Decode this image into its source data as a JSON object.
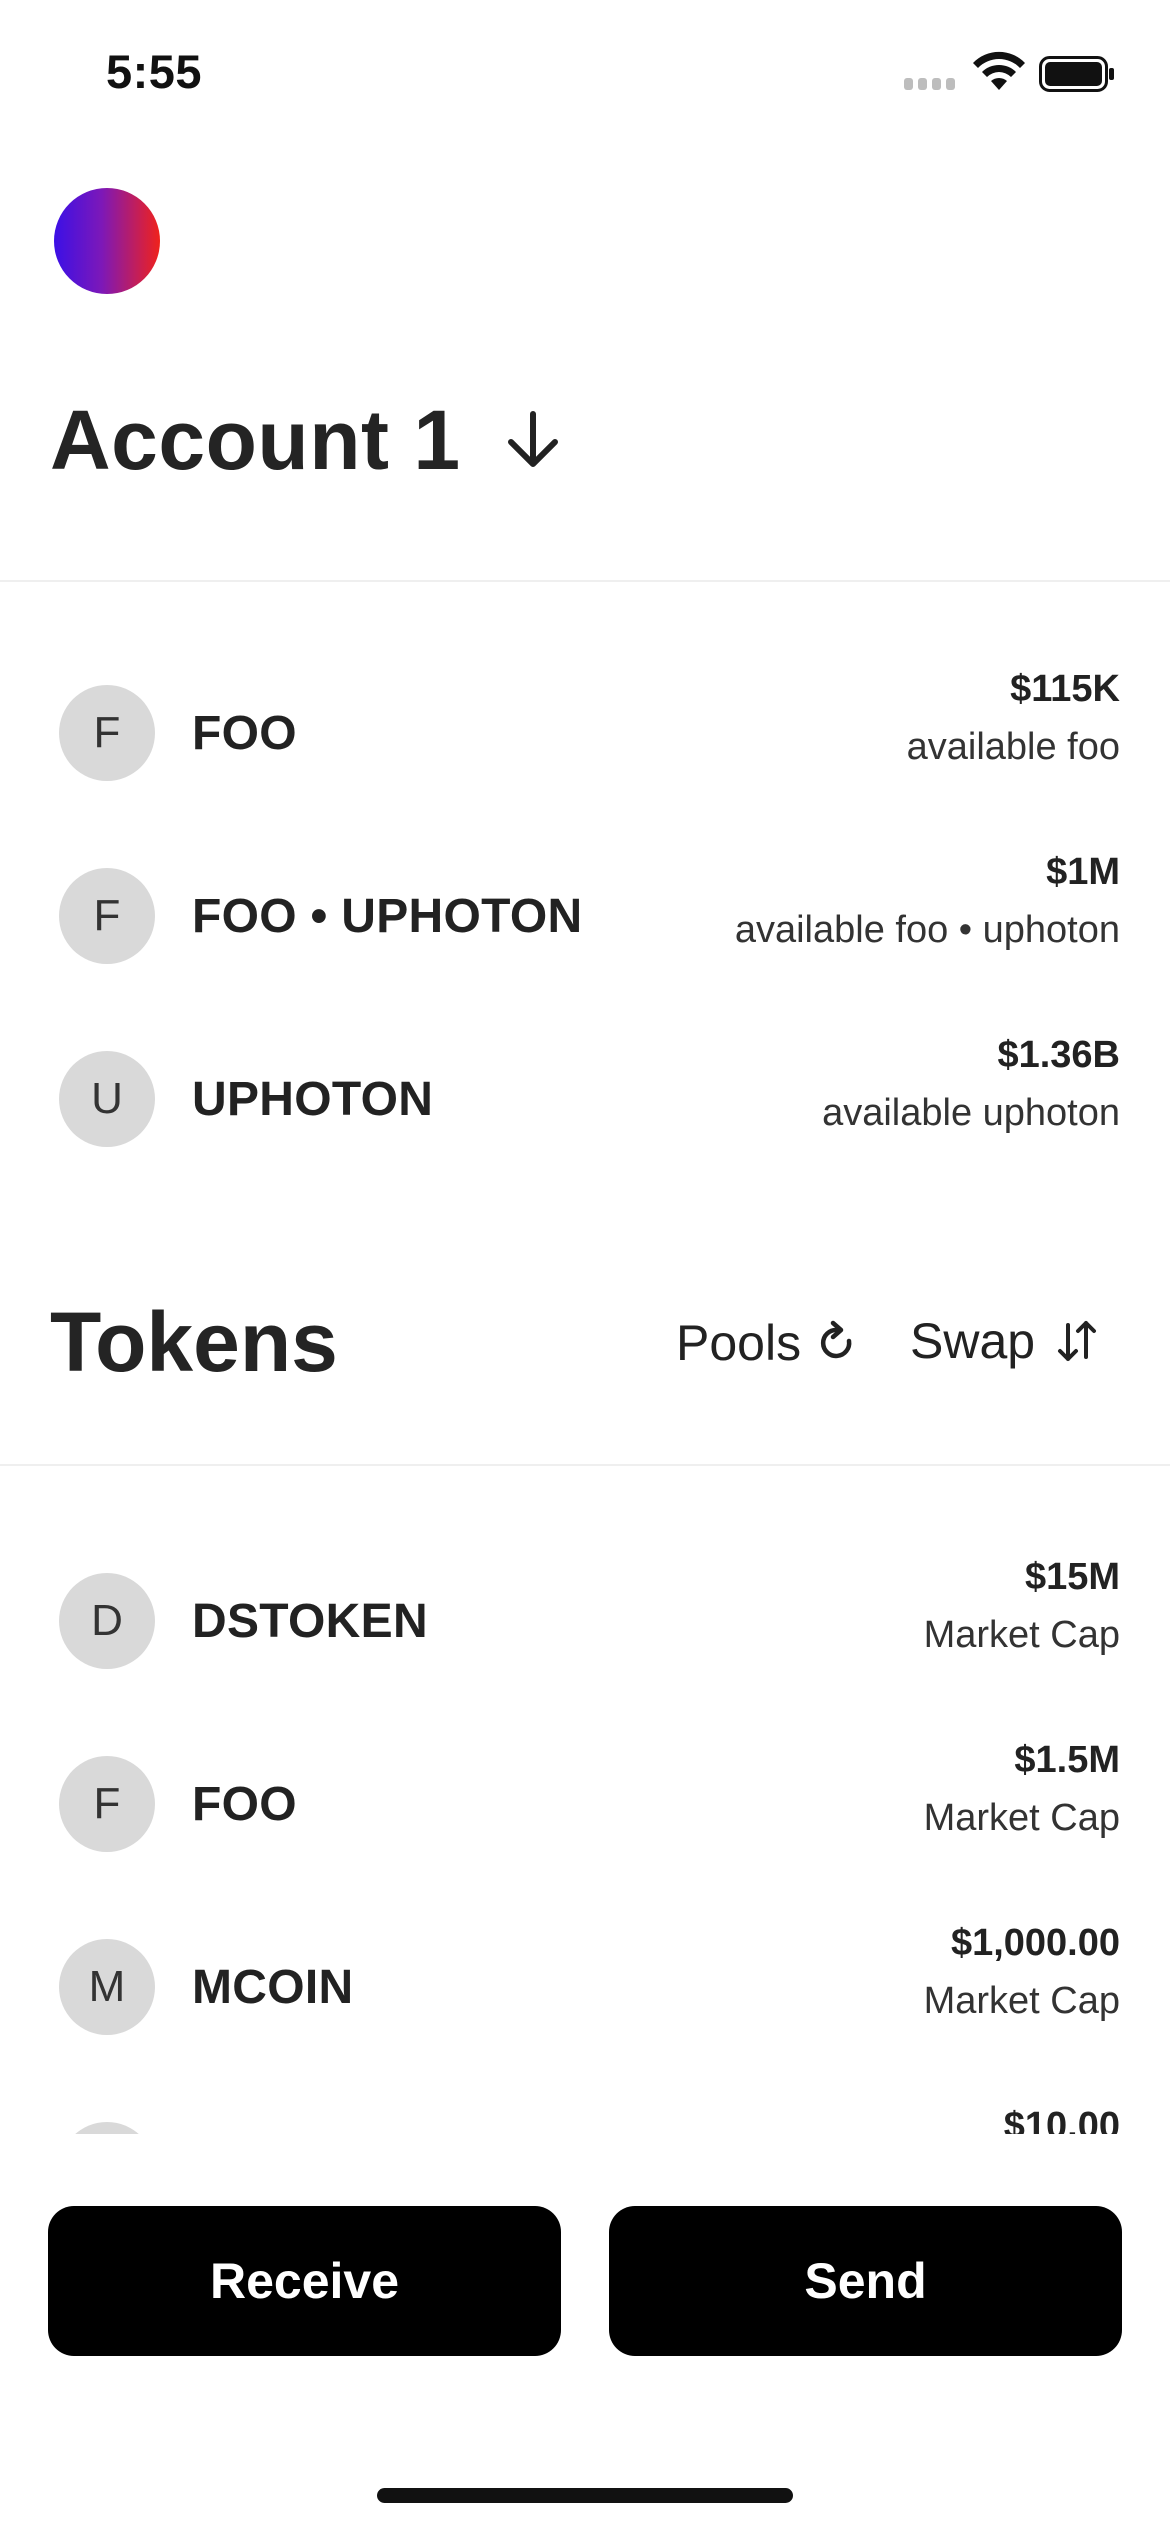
{
  "status_bar": {
    "time": "5:55"
  },
  "account": {
    "title": "Account 1"
  },
  "balances": [
    {
      "letter": "F",
      "name": "FOO",
      "value": "$115K",
      "sub": "available foo"
    },
    {
      "letter": "F",
      "name": "FOO • UPHOTON",
      "value": "$1M",
      "sub": "available foo • uphoton"
    },
    {
      "letter": "U",
      "name": "UPHOTON",
      "value": "$1.36B",
      "sub": "available uphoton"
    }
  ],
  "tokens_section": {
    "title": "Tokens",
    "pools_label": "Pools",
    "swap_label": "Swap"
  },
  "tokens": [
    {
      "letter": "D",
      "name": "DSTOKEN",
      "value": "$15M",
      "sub": "Market Cap"
    },
    {
      "letter": "F",
      "name": "FOO",
      "value": "$1.5M",
      "sub": "Market Cap"
    },
    {
      "letter": "M",
      "name": "MCOIN",
      "value": "$1,000.00",
      "sub": "Market Cap"
    },
    {
      "letter": "",
      "name": "",
      "value": "$10.00",
      "sub": ""
    }
  ],
  "actions": {
    "receive_label": "Receive",
    "send_label": "Send"
  }
}
